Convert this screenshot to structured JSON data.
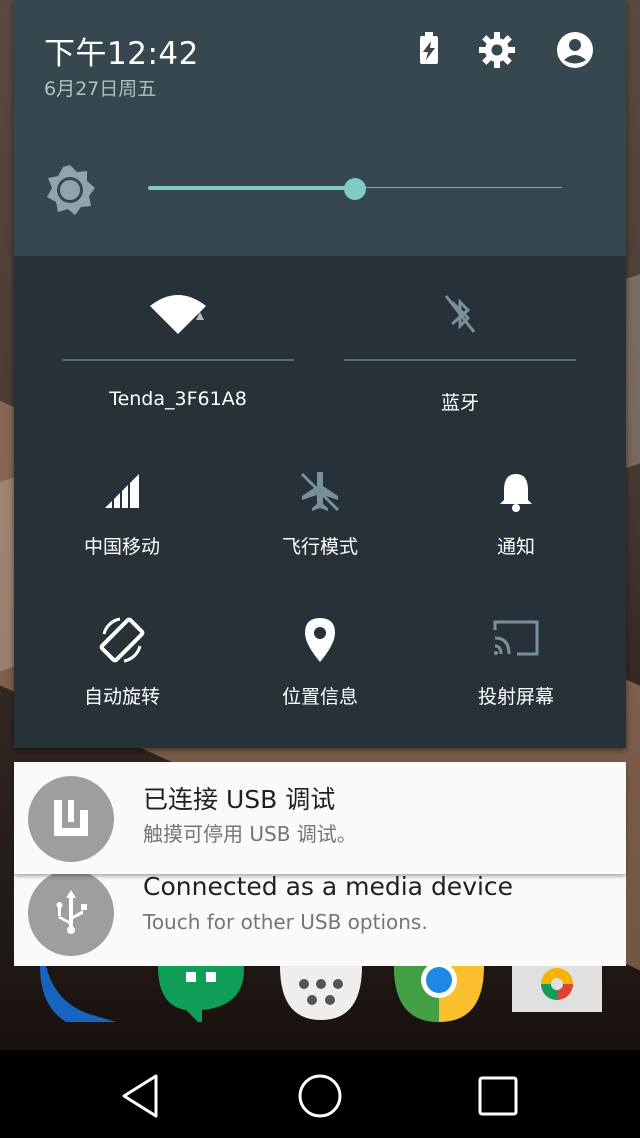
{
  "status": {
    "time": "下午12:42",
    "date": "6月27日周五",
    "icons": [
      "battery-charging-icon",
      "settings-icon",
      "account-icon"
    ]
  },
  "brightness": {
    "icon": "brightness-icon",
    "level": 0.5
  },
  "tiles": {
    "wifi": {
      "label": "Tenda_3F61A8",
      "icon": "wifi-icon"
    },
    "bluetooth": {
      "label": "蓝牙",
      "icon": "bluetooth-off-icon"
    },
    "mobile": {
      "label": "中国移动",
      "icon": "signal-icon"
    },
    "airplane": {
      "label": "飞行模式",
      "icon": "airplane-icon"
    },
    "notification": {
      "label": "通知",
      "icon": "bell-icon"
    },
    "rotate": {
      "label": "自动旋转",
      "icon": "rotate-icon"
    },
    "location": {
      "label": "位置信息",
      "icon": "location-icon"
    },
    "cast": {
      "label": "投射屏幕",
      "icon": "cast-icon"
    }
  },
  "notifications": [
    {
      "title": "已连接 USB 调试",
      "text": "触摸可停用 USB 调试。",
      "icon": "usb-debug-icon"
    },
    {
      "title": "Connected as a media device",
      "text": "Touch for other USB options.",
      "icon": "usb-icon"
    }
  ],
  "navbar": {
    "icons": [
      "back-icon",
      "home-icon",
      "recents-icon"
    ]
  },
  "colors": {
    "panel": "#263238",
    "header": "#37474f",
    "accent": "#80cbc4",
    "notification_bg": "#fafafa"
  }
}
